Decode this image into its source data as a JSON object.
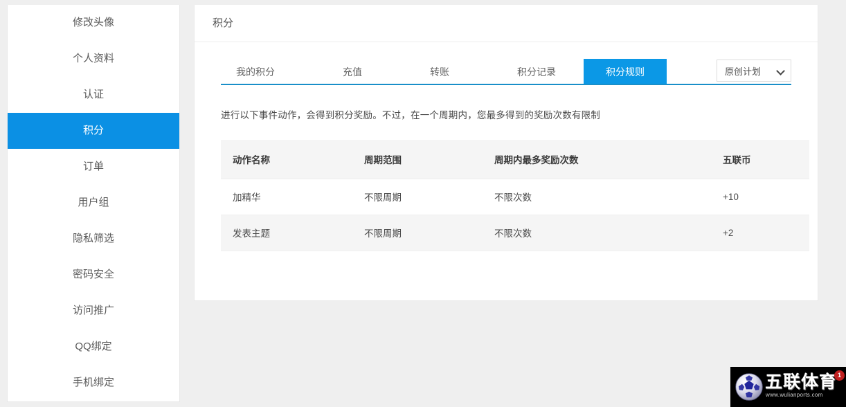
{
  "sidebar": {
    "items": [
      {
        "label": "修改头像",
        "active": false
      },
      {
        "label": "个人资料",
        "active": false
      },
      {
        "label": "认证",
        "active": false
      },
      {
        "label": "积分",
        "active": true
      },
      {
        "label": "订单",
        "active": false
      },
      {
        "label": "用户组",
        "active": false
      },
      {
        "label": "隐私筛选",
        "active": false
      },
      {
        "label": "密码安全",
        "active": false
      },
      {
        "label": "访问推广",
        "active": false
      },
      {
        "label": "QQ绑定",
        "active": false
      },
      {
        "label": "手机绑定",
        "active": false
      }
    ]
  },
  "panel": {
    "title": "积分",
    "tabs": [
      {
        "label": "我的积分",
        "active": false
      },
      {
        "label": "充值",
        "active": false
      },
      {
        "label": "转账",
        "active": false
      },
      {
        "label": "积分记录",
        "active": false
      },
      {
        "label": "积分规则",
        "active": true
      }
    ],
    "plan_select": {
      "value": "原创计划",
      "icon": "chevron-down-icon"
    },
    "description": "进行以下事件动作，会得到积分奖励。不过，在一个周期内，您最多得到的奖励次数有限制",
    "table": {
      "headers": [
        "动作名称",
        "周期范围",
        "周期内最多奖励次数",
        "五联币"
      ],
      "rows": [
        [
          "加精华",
          "不限周期",
          "不限次数",
          "+10"
        ],
        [
          "发表主题",
          "不限周期",
          "不限次数",
          "+2"
        ]
      ]
    }
  },
  "watermark": {
    "brand": "五联体育",
    "url": "www.wulianports.com",
    "badge": "1"
  },
  "colors": {
    "accent_blue": "#0b90e4",
    "tab_blue": "#0b98e6",
    "underline_blue": "#1a8fc9",
    "page_bg": "#efefef",
    "table_header_bg": "#f5f5f5"
  }
}
